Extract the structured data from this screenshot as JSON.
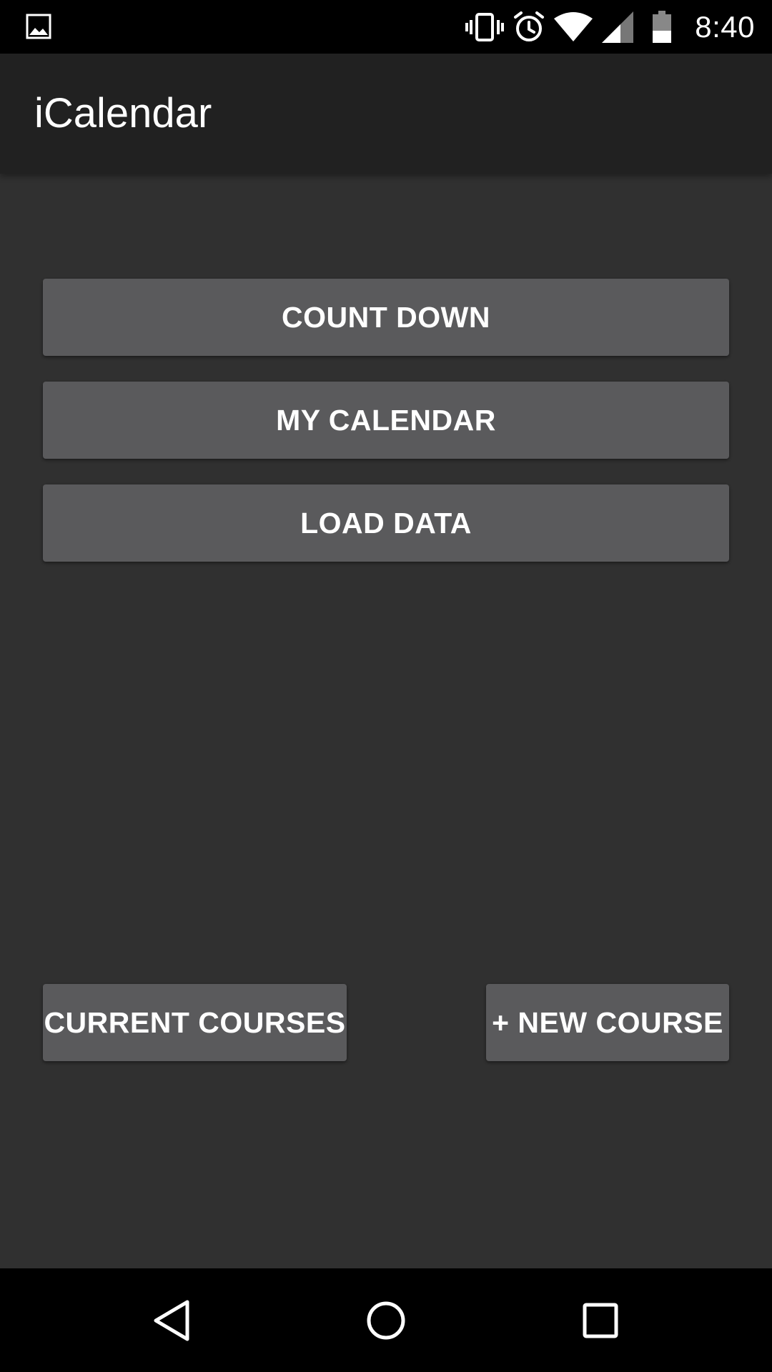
{
  "status_bar": {
    "time": "8:40",
    "icons": [
      "image-icon",
      "vibrate-icon",
      "alarm-icon",
      "wifi-icon",
      "cell-signal-icon",
      "battery-icon"
    ]
  },
  "action_bar": {
    "title": "iCalendar"
  },
  "main": {
    "buttons": [
      {
        "label": "COUNT DOWN"
      },
      {
        "label": "MY CALENDAR"
      },
      {
        "label": "LOAD DATA"
      }
    ],
    "bottom_buttons": {
      "current_courses": "CURRENT COURSES",
      "new_course": "+ NEW COURSE"
    }
  },
  "nav_bar": {
    "icons": [
      "back-icon",
      "home-icon",
      "recents-icon"
    ]
  },
  "colors": {
    "background": "#303030",
    "action_bar": "#212121",
    "button": "#5a5a5c",
    "text": "#ffffff",
    "system_bars": "#000000"
  }
}
